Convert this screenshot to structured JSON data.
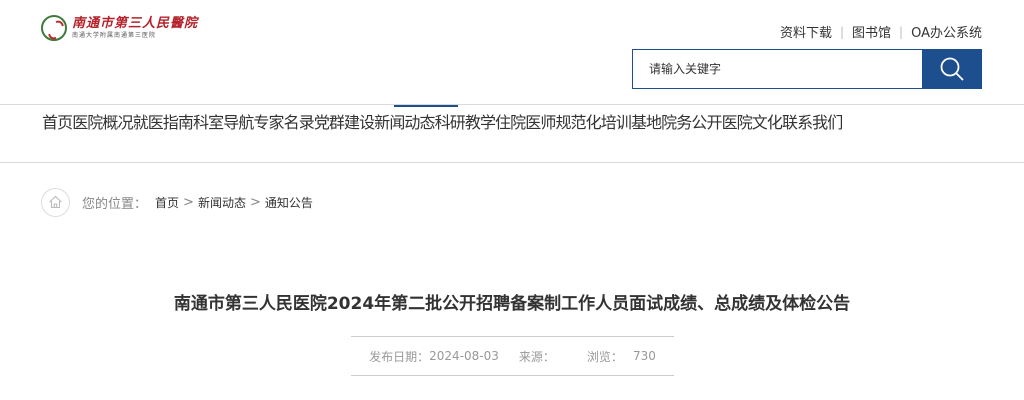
{
  "header": {
    "logo_name": "南通市第三人民醫院",
    "logo_sub": "南通大学附属南通第三医院",
    "top_links": [
      "资料下载",
      "图书馆",
      "OA办公系统"
    ],
    "search_placeholder": "请输入关键字"
  },
  "nav": {
    "items": [
      "首页",
      "医院概况",
      "就医指南",
      "科室导航",
      "专家名录",
      "党群建设",
      "新闻动态",
      "科研教学",
      "住院医师规范化培训基地",
      "院务公开",
      "医院文化",
      "联系我们"
    ],
    "active": "新闻动态"
  },
  "breadcrumb": {
    "label": "您的位置：",
    "items": [
      "首页",
      "新闻动态",
      "通知公告"
    ],
    "separator": ">"
  },
  "article": {
    "title": "南通市第三人民医院2024年第二批公开招聘备案制工作人员面试成绩、总成绩及体检公告",
    "date_label": "发布日期：",
    "date": "2024-08-03",
    "source_label": "来源：",
    "views_label": "浏览：",
    "views": "730"
  },
  "colors": {
    "primary": "#1d4f8e",
    "text": "#333333",
    "muted": "#999999"
  }
}
